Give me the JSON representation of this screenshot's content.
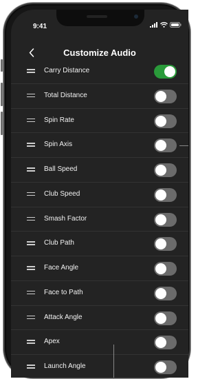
{
  "status_bar": {
    "time": "9:41",
    "icons": [
      "signal-icon",
      "wifi-icon",
      "battery-icon"
    ]
  },
  "nav": {
    "back_icon": "chevron-left-icon",
    "title": "Customize Audio"
  },
  "colors": {
    "background": "#232323",
    "toggle_on": "#2a9a3a",
    "toggle_off": "#6b6b6b"
  },
  "settings": [
    {
      "label": "Carry Distance",
      "enabled": true
    },
    {
      "label": "Total Distance",
      "enabled": false
    },
    {
      "label": "Spin Rate",
      "enabled": false
    },
    {
      "label": "Spin Axis",
      "enabled": false
    },
    {
      "label": "Ball Speed",
      "enabled": false
    },
    {
      "label": "Club Speed",
      "enabled": false
    },
    {
      "label": "Smash Factor",
      "enabled": false
    },
    {
      "label": "Club Path",
      "enabled": false
    },
    {
      "label": "Face Angle",
      "enabled": false
    },
    {
      "label": "Face to Path",
      "enabled": false
    },
    {
      "label": "Attack Angle",
      "enabled": false
    },
    {
      "label": "Apex",
      "enabled": false
    },
    {
      "label": "Launch Angle",
      "enabled": false
    }
  ]
}
